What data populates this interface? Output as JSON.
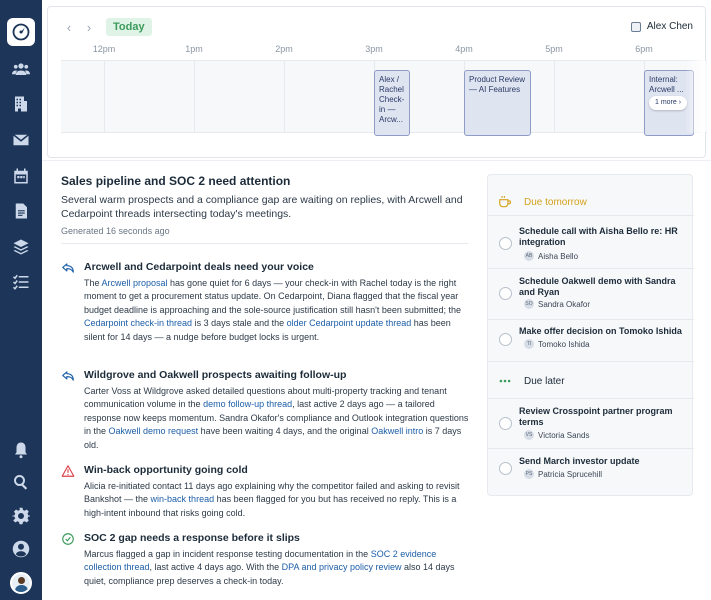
{
  "sidebar": {
    "items": [
      {
        "icon": "dashboard-icon",
        "active": true
      },
      {
        "icon": "people-icon"
      },
      {
        "icon": "building-icon"
      },
      {
        "icon": "mail-icon"
      },
      {
        "icon": "calendar-icon"
      },
      {
        "icon": "document-icon"
      },
      {
        "icon": "layers-icon"
      },
      {
        "icon": "checklist-icon"
      }
    ],
    "bottom_items": [
      {
        "icon": "bell-icon"
      },
      {
        "icon": "search-icon"
      },
      {
        "icon": "settings-icon"
      },
      {
        "icon": "account-icon"
      }
    ]
  },
  "calendar": {
    "prev_label": "‹",
    "next_label": "›",
    "today_label": "Today",
    "user_filter_label": "Alex Chen",
    "hours": [
      "12pm",
      "1pm",
      "2pm",
      "3pm",
      "4pm",
      "5pm",
      "6pm"
    ],
    "events": [
      {
        "title": "Alex / Rachel Check-in — Arcw..."
      },
      {
        "title": "Product Review — AI Features"
      },
      {
        "title": "Internal: Arcwell ..."
      }
    ],
    "more_label": "1 more ›"
  },
  "summary": {
    "headline": "Sales pipeline and SOC 2 need attention",
    "subline": "Several warm prospects and a compliance gap are waiting on replies, with Arcwell and Cedarpoint threads intersecting today's meetings.",
    "generated": "Generated 16 seconds ago"
  },
  "insights": [
    {
      "icon": "reply-icon",
      "title": "Arcwell and Cedarpoint deals need your voice",
      "p1": "The ",
      "link1": "Arcwell proposal",
      "p2": " has gone quiet for 6 days — your check-in with Rachel today is the right moment to get a procurement status update. On Cedarpoint, Diana flagged that the fiscal year budget deadline is approaching and the sole-source justification still hasn't been submitted; the ",
      "link2": "Cedarpoint check-in thread",
      "p3": " is 3 days stale and the ",
      "link3": "older Cedarpoint update thread",
      "p4": " has been silent for 14 days — a nudge before budget locks is urgent."
    },
    {
      "icon": "reply-icon",
      "title": "Wildgrove and Oakwell prospects awaiting follow-up",
      "p1": "Carter Voss at Wildgrove asked detailed questions about multi-property tracking and tenant communication volume in the ",
      "link1": "demo follow-up thread",
      "p2": ", last active 2 days ago — a tailored response now keeps momentum. Sandra Okafor's compliance and Outlook integration questions in the ",
      "link2": "Oakwell demo request",
      "p3": " have been waiting 4 days, and the original ",
      "link3": "Oakwell intro",
      "p4": " is 7 days old."
    },
    {
      "icon": "warning-icon",
      "title": "Win-back opportunity going cold",
      "p1": "Alicia re-initiated contact 11 days ago explaining why the competitor failed and asking to revisit Bankshot — the ",
      "link1": "win-back thread",
      "p2": " has been flagged for you but has received no reply. This is a high-intent inbound that risks going cold."
    },
    {
      "icon": "check-circle-icon",
      "title": "SOC 2 gap needs a response before it slips",
      "p1": "Marcus flagged a gap in incident response testing documentation in the ",
      "link1": "SOC 2 evidence collection thread",
      "p2": ", last active 4 days ago. With the ",
      "link2": "DPA and privacy policy review",
      "p3": " also 14 days quiet, compliance prep deserves a check-in today."
    }
  ],
  "tasks_panel": {
    "due_tomorrow_label": "Due tomorrow",
    "due_later_label": "Due later",
    "due_tomorrow": [
      {
        "title": "Schedule call with Aisha Bello re: HR integration",
        "initials": "AB",
        "person": "Aisha Bello"
      },
      {
        "title": "Schedule Oakwell demo with Sandra and Ryan",
        "initials": "SO",
        "person": "Sandra Okafor"
      },
      {
        "title": "Make offer decision on Tomoko Ishida",
        "initials": "TI",
        "person": "Tomoko Ishida"
      }
    ],
    "due_later": [
      {
        "title": "Review Crosspoint partner program terms",
        "initials": "VS",
        "person": "Victoria Sands"
      },
      {
        "title": "Send March investor update",
        "initials": "PS",
        "person": "Patricia Sprucehill"
      }
    ]
  },
  "colors": {
    "sidebar": "#1c3558",
    "accent_link": "#1d5ea8",
    "due_tomorrow": "#d4a21f",
    "due_later": "#3d9b5c",
    "warning": "#d9434a"
  }
}
